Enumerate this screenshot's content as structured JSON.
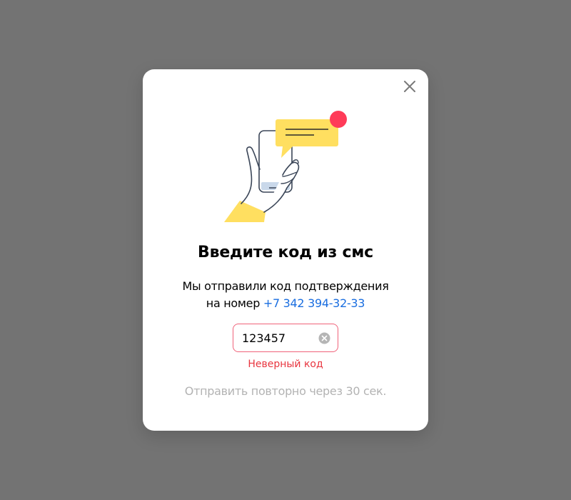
{
  "dialog": {
    "title": "Введите код из смс",
    "description_line1": "Мы отправили код подтверждения",
    "description_line2_prefix": "на номер",
    "phone_number": "+7 342 394-32-33",
    "code_value": "123457",
    "error_text": "Неверный код",
    "resend_text": "Отправить повторно через 30 сек.",
    "close_icon": "close-icon",
    "clear_icon": "clear-circle-icon",
    "illustration": "phone-sms-illustration"
  },
  "colors": {
    "backdrop": "#737373",
    "link": "#1a6ee0",
    "error": "#e8353f",
    "input_error_border": "#f0637a",
    "accent_yellow": "#ffdf60",
    "notification_red": "#ff3b58",
    "muted": "#b3b3b3"
  }
}
